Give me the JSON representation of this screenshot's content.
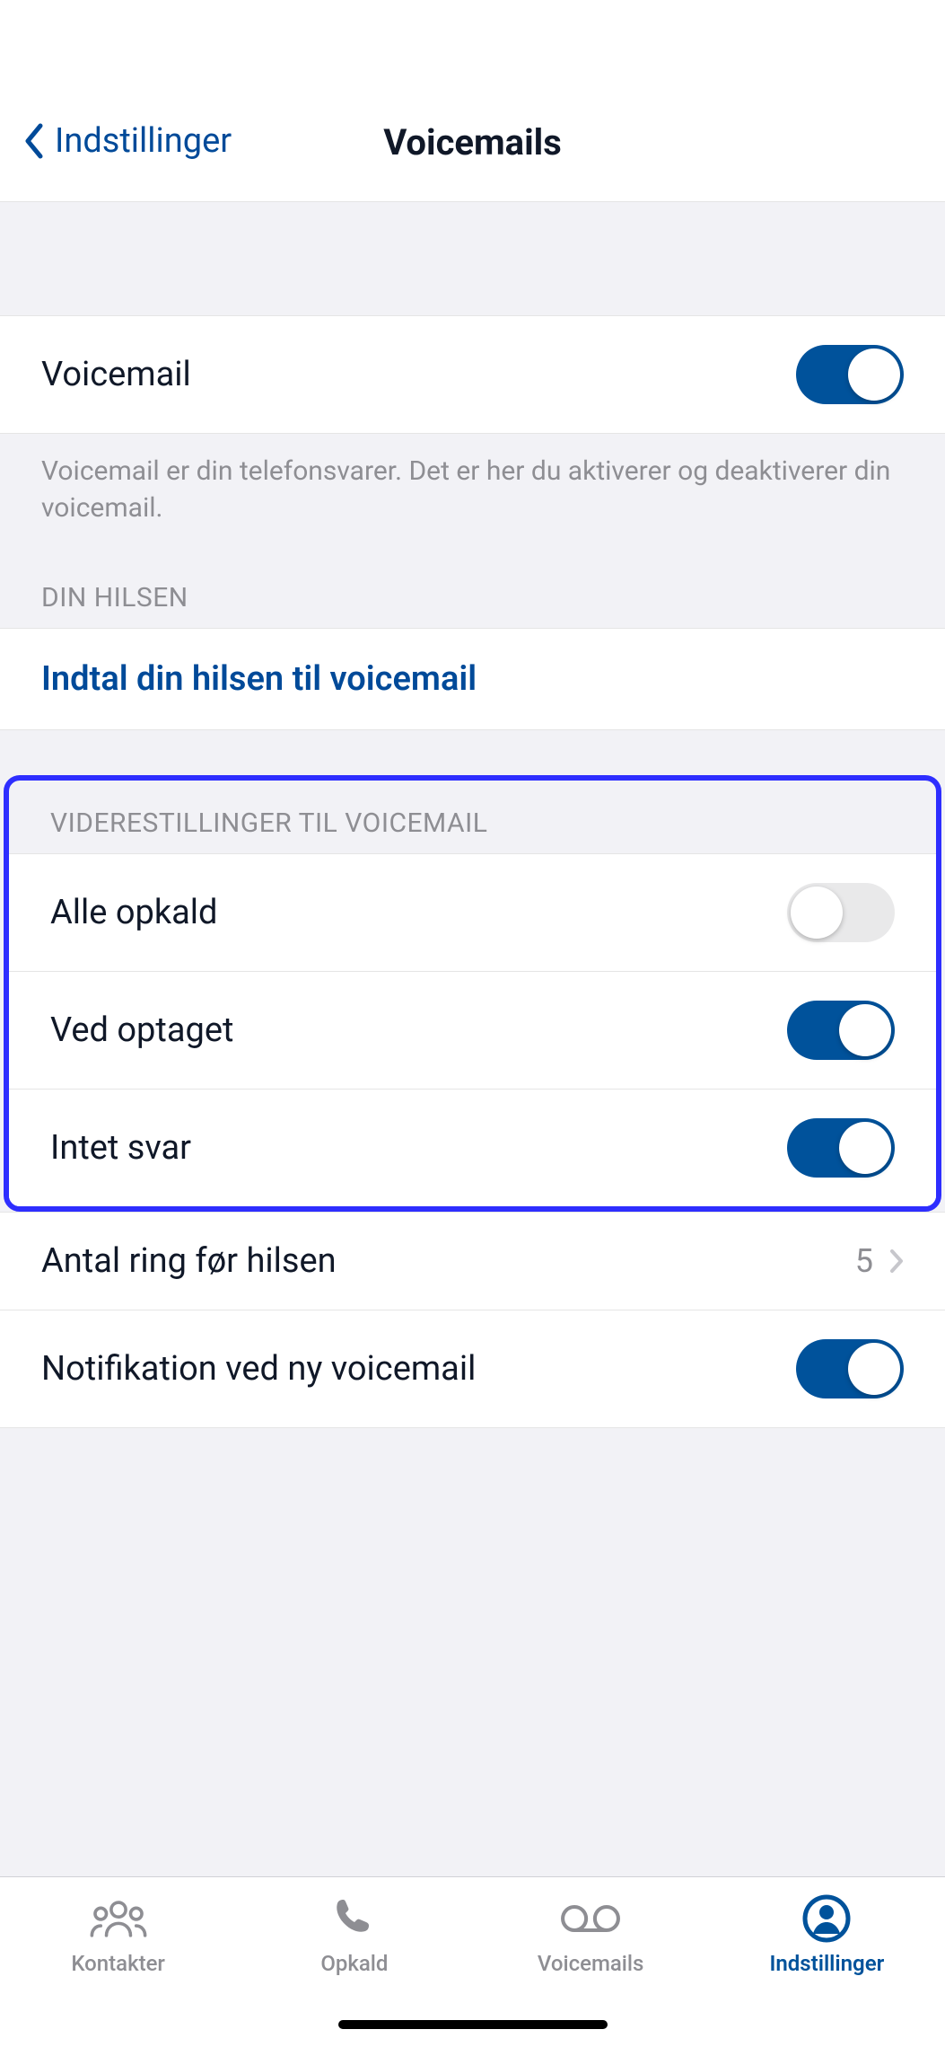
{
  "header": {
    "back_label": "Indstillinger",
    "title": "Voicemails"
  },
  "voicemail": {
    "label": "Voicemail",
    "enabled": true,
    "description": "Voicemail er din telefonsvarer. Det er her du aktiverer og deaktiverer din voicemail."
  },
  "greeting": {
    "section_title": "DIN HILSEN",
    "link_label": "Indtal din hilsen til voicemail"
  },
  "forwarding": {
    "section_title": "VIDERESTILLINGER TIL VOICEMAIL",
    "rows": [
      {
        "label": "Alle opkald",
        "enabled": false
      },
      {
        "label": "Ved optaget",
        "enabled": true
      },
      {
        "label": "Intet svar",
        "enabled": true
      }
    ]
  },
  "ring_count": {
    "label": "Antal ring før hilsen",
    "value": "5"
  },
  "notification": {
    "label": "Notifikation ved ny voicemail",
    "enabled": true
  },
  "tabs": [
    {
      "label": "Kontakter",
      "icon": "contacts",
      "active": false
    },
    {
      "label": "Opkald",
      "icon": "phone",
      "active": false
    },
    {
      "label": "Voicemails",
      "icon": "voicemail",
      "active": false
    },
    {
      "label": "Indstillinger",
      "icon": "settings-profile",
      "active": true
    }
  ],
  "colors": {
    "accent": "#00529b",
    "link": "#004a99",
    "highlight_border": "#2e2eff"
  }
}
